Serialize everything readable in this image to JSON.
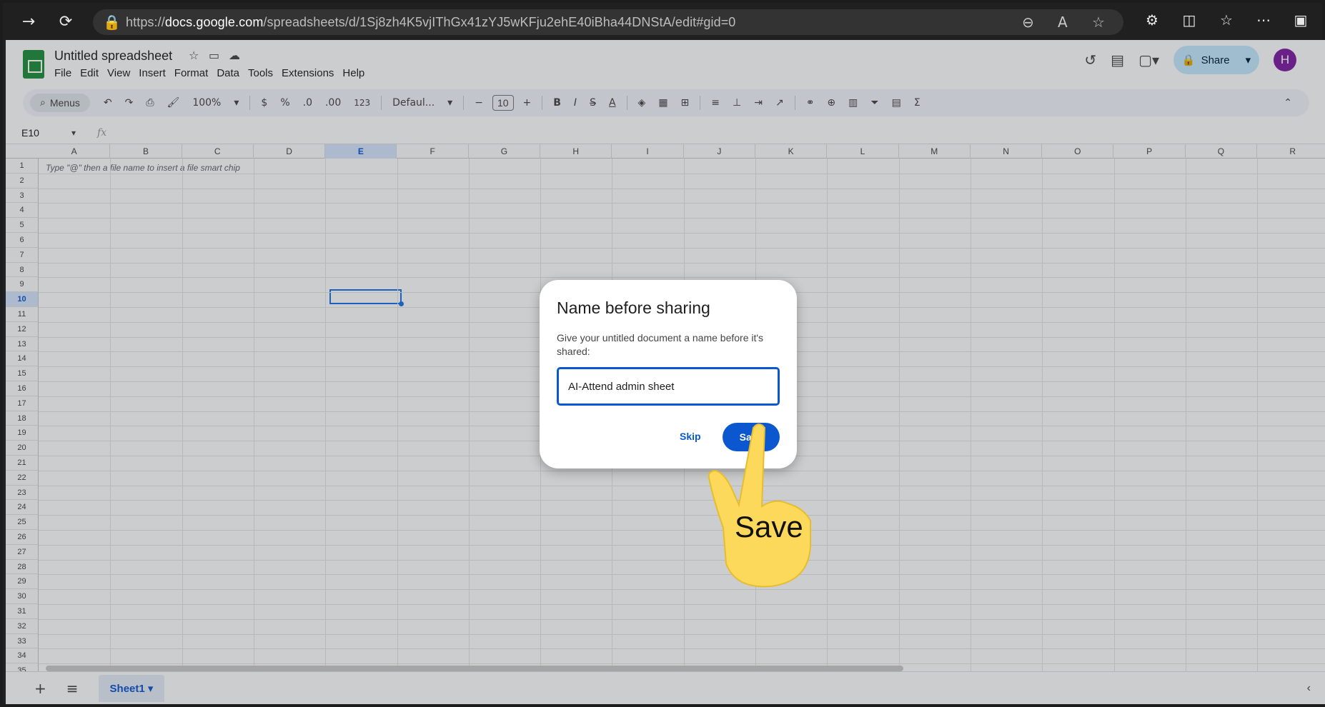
{
  "browser": {
    "url_prefix": "https://",
    "url_host": "docs.google.com",
    "url_path": "/spreadsheets/d/1Sj8zh4K5vjIThGx41zYJ5wKFju2ehE40iBha44DNStA/edit#gid=0",
    "nav_icons": [
      "forward-arrow-icon",
      "reload-icon",
      "site-info-icon"
    ],
    "right_icons": [
      "zoom-out-icon",
      "read-aloud-icon",
      "favorite-star-icon",
      "extensions-icon",
      "split-screen-icon",
      "favorites-icon",
      "more-icon",
      "sidebar-icon"
    ]
  },
  "doc": {
    "title": "Untitled spreadsheet",
    "menu": [
      "File",
      "Edit",
      "View",
      "Insert",
      "Format",
      "Data",
      "Tools",
      "Extensions",
      "Help"
    ],
    "share_label": "Share",
    "avatar_letter": "H"
  },
  "toolbar": {
    "menus_label": "Menus",
    "zoom": "100%",
    "currency": "$",
    "percent": "%",
    "dec_decrease": ".0",
    "dec_increase": ".00",
    "format_123": "123",
    "font": "Defaul...",
    "font_size": "10",
    "bold": "B",
    "italic": "I"
  },
  "formula_bar": {
    "cell_ref": "E10",
    "fx": "fx"
  },
  "grid": {
    "columns": [
      "A",
      "B",
      "C",
      "D",
      "E",
      "F",
      "G",
      "H",
      "I",
      "J",
      "K",
      "L",
      "M",
      "N",
      "O",
      "P",
      "Q",
      "R"
    ],
    "selected_column": "E",
    "selected_row": "10",
    "hint": "Type \"@\" then a file name to insert a file smart chip"
  },
  "sheets": {
    "active": "Sheet1"
  },
  "dialog": {
    "title": "Name before sharing",
    "body": "Give your untitled document a name before it's shared:",
    "input_value": "AI-Attend admin sheet",
    "skip_label": "Skip",
    "save_label": "Save"
  },
  "annotation": {
    "label": "Save"
  },
  "colors": {
    "accent": "#0b57d0",
    "sheets_green": "#1e8e3e",
    "avatar": "#7b1fa2",
    "share_bg": "#c2e7ff",
    "hand": "#fcd95a"
  }
}
